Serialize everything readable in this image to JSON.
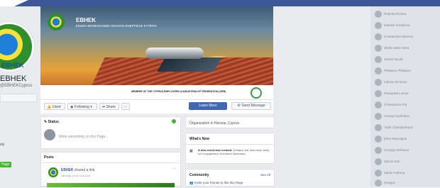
{
  "page": {
    "name": "EBHEK",
    "handle": "@EBHEKCyprus",
    "logo_text": "EBHEK",
    "left_links": [
      "ely",
      "",
      ""
    ],
    "left_button": "Page"
  },
  "cover": {
    "title": "EBHEK",
    "subtitle": "ΕΝΩΣΗ ΒΙΟΜΗΧΑΝΩΝ ΗΛΙΑΚΗΣ ΕΝΕΡΓΕΙΑΣ ΚΥΠΡΟΥ",
    "member_text": "MEMBER OF THE CYPRUS EMPLOYERS & INDUSTRIALIST FEDERATION (OEB)",
    "oeb_label": "OEB"
  },
  "actions": {
    "liked": "Liked",
    "following": "Following",
    "share": "Share",
    "more": "···",
    "learn_more": "Learn More",
    "send_message": "Send Message"
  },
  "status": {
    "title": "Status",
    "placeholder": "Write something on this Page..."
  },
  "posts": {
    "title": "Posts",
    "author": "EBHEK",
    "action": "shared a link.",
    "time": "January 15 at 10:51am"
  },
  "about": {
    "location": "Organization in Nicosia, Cyprus"
  },
  "whats_new": {
    "title": "What's New",
    "item_lead": "A new event was created:",
    "item_text": "Απόψεις για Ταλα στην πόλη των ενεργειακών πολιτικών Μελεταών"
  },
  "community": {
    "title": "Community",
    "see_all": "See All",
    "invite": "Invite your friends to like this Page"
  },
  "sidebar_friends": [
    "Roberta Riviera",
    "Sdenka Vorobieva",
    "Constantine Stevens",
    "Stella Vittrie Zena",
    "James Nicolli",
    "Philippos Philippou",
    "Ioanna Zenonos",
    "Panayiota Loizou",
    "Christoforos Pat",
    "George Kyrkiakou",
    "Andri Charalambous",
    "Eleni Mavrogeni",
    "Georgia Stefanou",
    "Marios Kos",
    "Maria Andreou",
    "Giorgos"
  ]
}
